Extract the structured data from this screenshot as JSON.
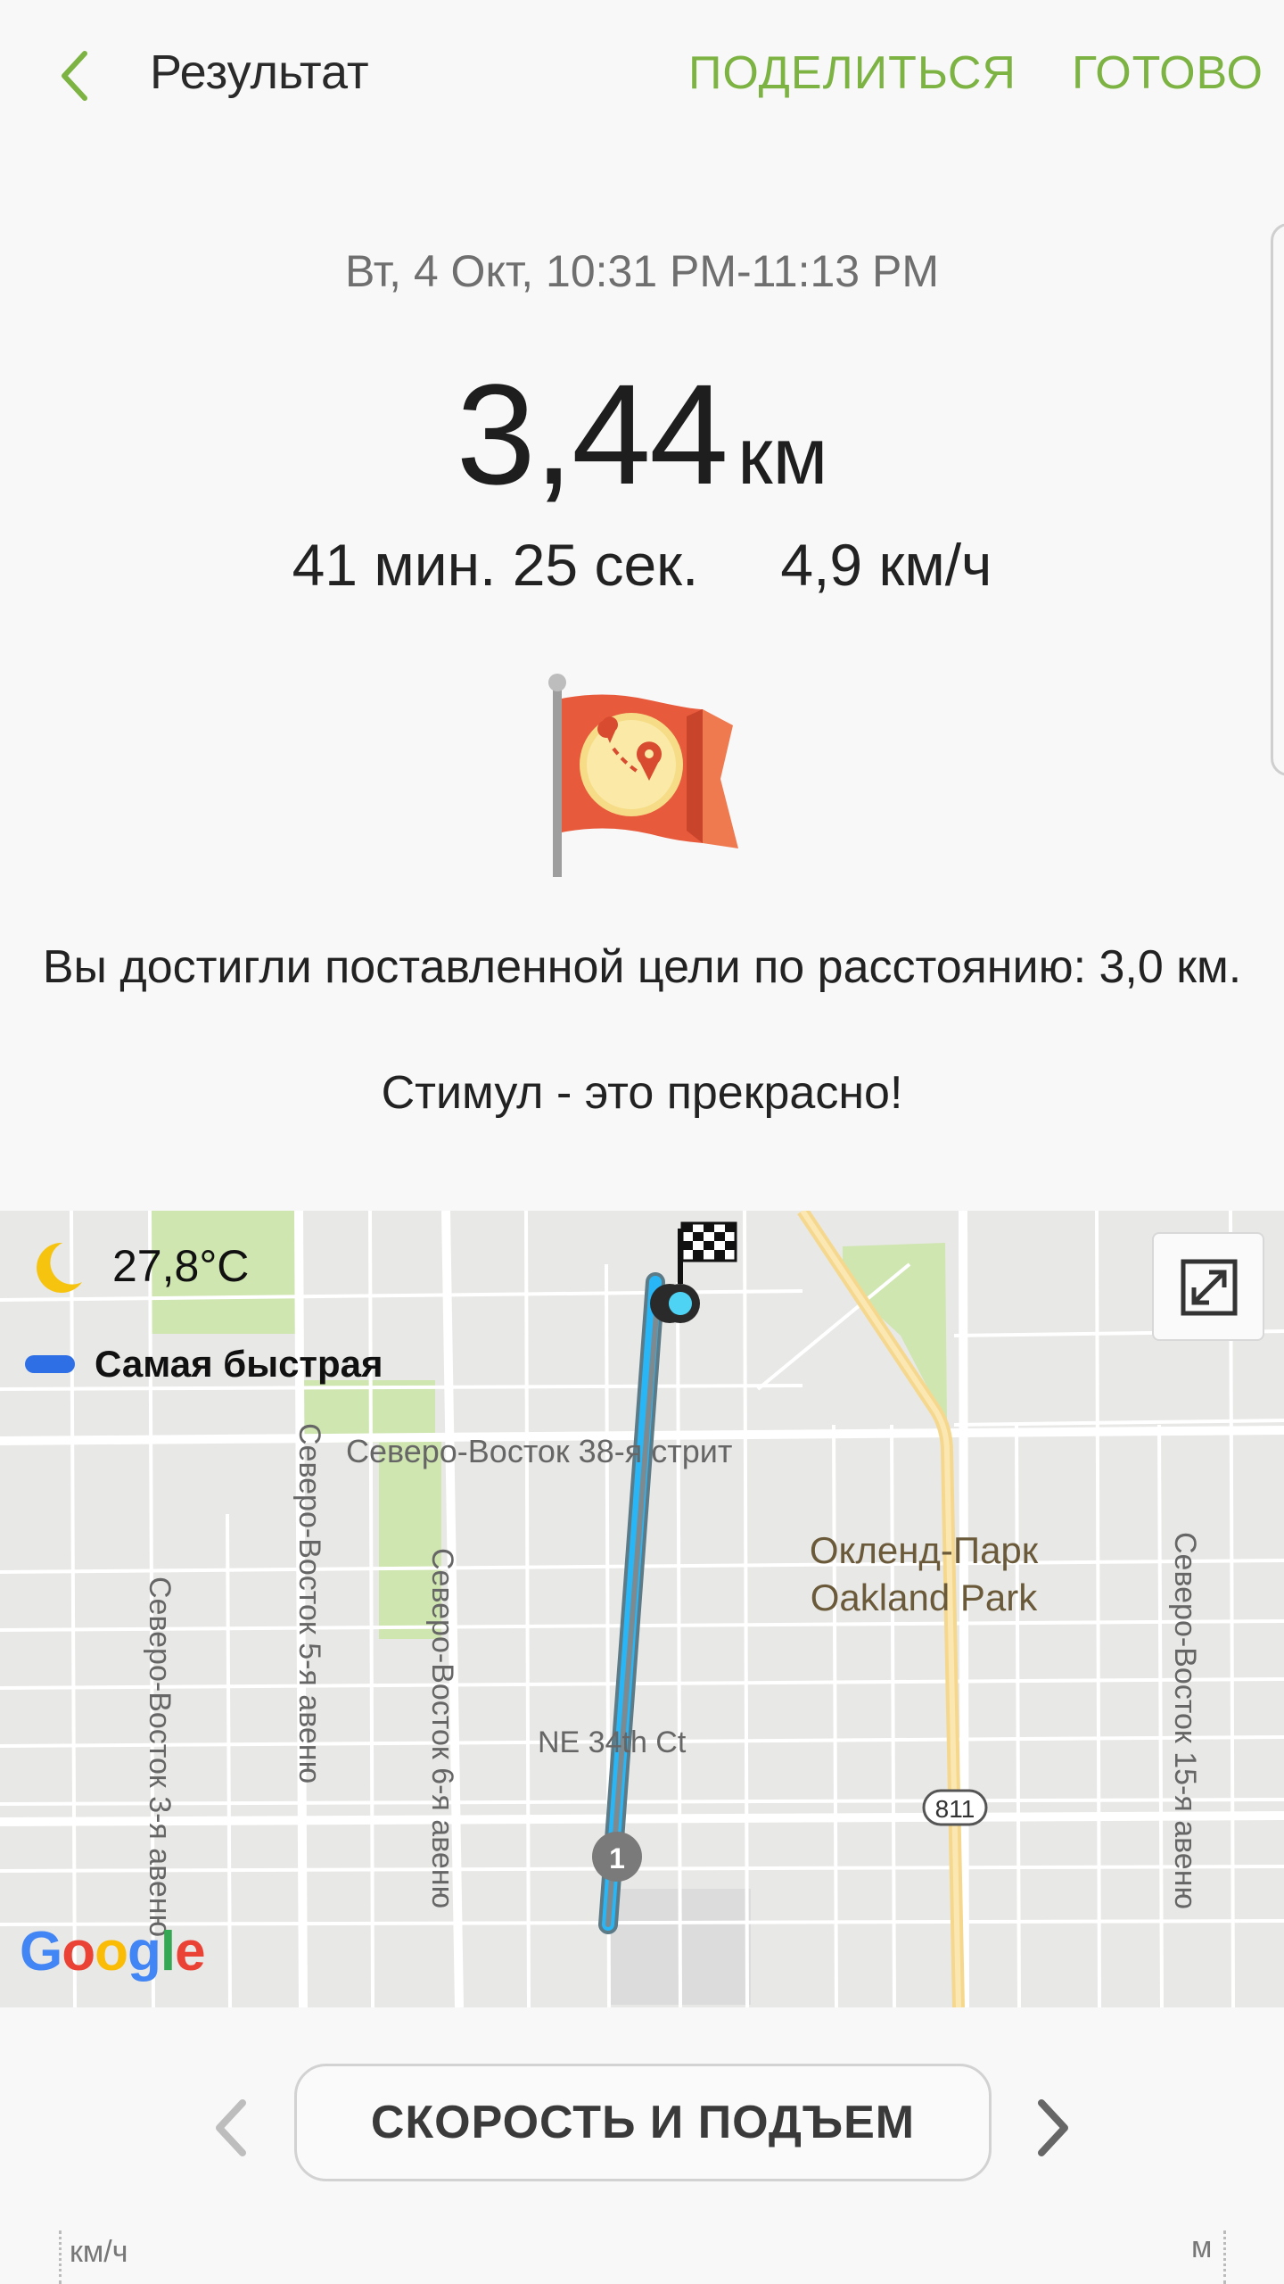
{
  "header": {
    "title": "Результат",
    "share_label": "ПОДЕЛИТЬСЯ",
    "done_label": "ГОТОВО"
  },
  "summary": {
    "date_range": "Вт, 4 Окт, 10:31 PM-11:13 PM",
    "distance_value": "3,44",
    "distance_unit": "км",
    "duration": "41 мин. 25 сек.",
    "avg_speed": "4,9 км/ч"
  },
  "achievement": {
    "goal_text": "Вы достигли поставленной цели по расстоянию: 3,0 км.",
    "motivation": "Стимул - это прекрасно!"
  },
  "map": {
    "temperature": "27,8°C",
    "legend_label": "Самая быстрая",
    "legend_color": "#2f6fe6",
    "route_color": "#29b6f6",
    "street_labels": {
      "ne38": "Северо-Восток 38-я стрит",
      "ne5": "Северо-Восток 5-я авеню",
      "ne6": "Северо-Восток 6-я авеню",
      "ne3": "Северо-Восток 3-я авеню",
      "ne15": "Северо-Восток 15-я авеню",
      "ne34ct": "NE 34th Ct",
      "oakland_ru": "Окленд-Парк",
      "oakland_en": "Oakland Park",
      "route811": "811"
    },
    "start_marker": "1",
    "google_logo": {
      "g1": "G",
      "o1": "o",
      "o2": "o",
      "g2": "g",
      "l": "l",
      "e": "e"
    }
  },
  "bottom": {
    "chart_type_label": "СКОРОСТЬ И ПОДЪЕМ",
    "unit_left": "км/ч",
    "unit_right": "м"
  }
}
